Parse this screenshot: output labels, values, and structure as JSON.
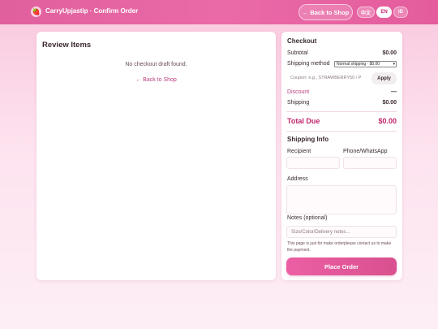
{
  "header": {
    "logo_glyph": "🍓",
    "brand": "CarryUpjastip · Confirm Order",
    "back_label": "← Back to Shop",
    "languages": [
      "中文",
      "EN",
      "ID"
    ],
    "active_language": "EN"
  },
  "review": {
    "title": "Review Items",
    "empty_message": "No checkout draft found.",
    "back_link": "← Back to Shop"
  },
  "checkout": {
    "title": "Checkout",
    "subtotal_label": "Subtotal",
    "subtotal_value": "$0.00",
    "shipping_method_label": "Shipping method",
    "shipping_method_selected": "Normal shipping · $0.00",
    "coupon_placeholder": "Coupon: e.g., STRAWBERRY50 / P",
    "apply_label": "Apply",
    "discount_label": "Discount",
    "discount_value": "—",
    "shipping_label": "Shipping",
    "shipping_value": "$0.00",
    "total_label": "Total Due",
    "total_value": "$0.00"
  },
  "shipping_info": {
    "title": "Shipping Info",
    "recipient_label": "Recipient",
    "phone_label": "Phone/WhatsApp",
    "address_label": "Address",
    "notes_label": "Notes (optional)",
    "notes_placeholder": "Size/Color/Delivery notes...",
    "info_note": "This page is just for make orderplease contact us to make the payment.",
    "place_order_label": "Place Order"
  },
  "colors": {
    "accent": "#e0609e",
    "total": "#c0246a"
  }
}
